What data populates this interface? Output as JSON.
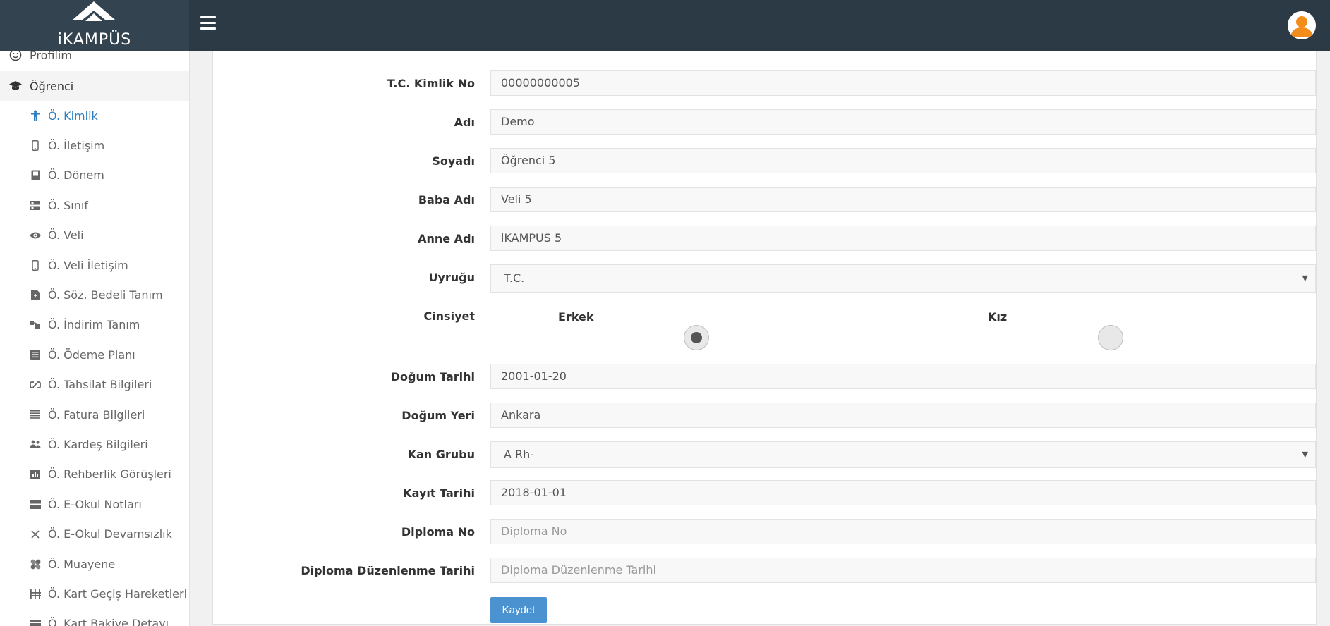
{
  "header": {
    "logo_text": "iKAMPÜS"
  },
  "sidebar": {
    "profile": "Profilim",
    "student": "Öğrenci",
    "items": [
      {
        "label": "Ö. Kimlik",
        "icon": "person-icon"
      },
      {
        "label": "Ö. İletişim",
        "icon": "phone-icon"
      },
      {
        "label": "Ö. Dönem",
        "icon": "book-icon"
      },
      {
        "label": "Ö. Sınıf",
        "icon": "class-icon"
      },
      {
        "label": "Ö. Veli",
        "icon": "eye-icon"
      },
      {
        "label": "Ö. Veli İletişim",
        "icon": "phone-icon"
      },
      {
        "label": "Ö. Söz. Bedeli Tanım",
        "icon": "contract-icon"
      },
      {
        "label": "Ö. İndirim Tanım",
        "icon": "discount-icon"
      },
      {
        "label": "Ö. Ödeme Planı",
        "icon": "payment-plan-icon"
      },
      {
        "label": "Ö. Tahsilat Bilgileri",
        "icon": "link-icon"
      },
      {
        "label": "Ö. Fatura Bilgileri",
        "icon": "list-icon"
      },
      {
        "label": "Ö. Kardeş Bilgileri",
        "icon": "siblings-icon"
      },
      {
        "label": "Ö. Rehberlik Görüşleri",
        "icon": "chart-icon"
      },
      {
        "label": "Ö. E-Okul Notları",
        "icon": "grades-icon"
      },
      {
        "label": "Ö. E-Okul Devamsızlık",
        "icon": "cross-icon"
      },
      {
        "label": "Ö. Muayene",
        "icon": "bandage-icon"
      },
      {
        "label": "Ö. Kart Geçiş Hareketleri",
        "icon": "transit-icon"
      },
      {
        "label": "Ö. Kart Bakiye Detayı",
        "icon": "card-icon"
      }
    ]
  },
  "form": {
    "tc_label": "T.C. Kimlik No",
    "tc_value": "00000000005",
    "name_label": "Adı",
    "name_value": "Demo",
    "surname_label": "Soyadı",
    "surname_value": "Öğrenci 5",
    "father_label": "Baba Adı",
    "father_value": "Veli 5",
    "mother_label": "Anne Adı",
    "mother_value": "iKAMPUS 5",
    "nationality_label": "Uyruğu",
    "nationality_value": "T.C.",
    "gender_label": "Cinsiyet",
    "gender_male": "Erkek",
    "gender_female": "Kız",
    "gender_selected": "Erkek",
    "birthdate_label": "Doğum Tarihi",
    "birthdate_value": "2001-01-20",
    "birthplace_label": "Doğum Yeri",
    "birthplace_value": "Ankara",
    "blood_label": "Kan Grubu",
    "blood_value": "A Rh-",
    "regdate_label": "Kayıt Tarihi",
    "regdate_value": "2018-01-01",
    "diploma_label": "Diploma No",
    "diploma_placeholder": "Diploma No",
    "diploma_date_label": "Diploma Düzenlenme Tarihi",
    "diploma_date_placeholder": "Diploma Düzenlenme Tarihi",
    "save_label": "Kaydet"
  },
  "colors": {
    "topbar": "#2b3a45",
    "accent": "#2c7ec0",
    "button": "#4b93d0",
    "avatar": "#f28c1a"
  }
}
